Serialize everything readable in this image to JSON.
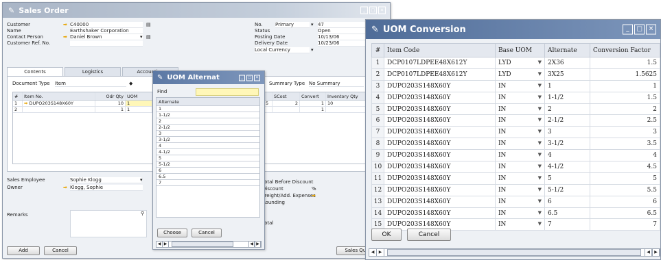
{
  "sales_order": {
    "title": "Sales Order",
    "left_fields": [
      {
        "label": "Customer",
        "value": "C40000",
        "arrow": true
      },
      {
        "label": "Name",
        "value": "Earthshaker Corporation",
        "arrow": false
      },
      {
        "label": "Contact Person",
        "value": "Daniel Brown",
        "arrow": true
      },
      {
        "label": "Customer Ref. No.",
        "value": "",
        "arrow": false
      }
    ],
    "right_fields": [
      {
        "label": "No.",
        "value": "Primary",
        "value2": "47"
      },
      {
        "label": "Status",
        "value": "Open"
      },
      {
        "label": "Posting Date",
        "value": "10/13/06"
      },
      {
        "label": "Delivery Date",
        "value": "10/23/06"
      }
    ],
    "currency": "Local Currency",
    "tabs": [
      "Contents",
      "Logistics",
      "Accounting"
    ],
    "doc_type_label": "Document Type",
    "doc_type_value": "Item",
    "summary_type_label": "Summary Type",
    "summary_type_value": "No Summary",
    "grid_headers": [
      "#",
      "Item No.",
      "Odr Qty",
      "UOM"
    ],
    "grid_rows": [
      {
        "n": "1",
        "item": "DUPO203S148X60Y",
        "qty": "10",
        "uom": "1"
      },
      {
        "n": "2",
        "item": "",
        "qty": "1",
        "uom": "1"
      }
    ],
    "right_grid_headers": [
      "SCost",
      "Convert",
      "Inventory Qty"
    ],
    "right_grid_rows": [
      {
        "a": "5",
        "b": "2",
        "c": "1",
        "d": "10"
      },
      {
        "a": "",
        "b": "",
        "c": "1",
        "d": ""
      }
    ],
    "sales_employee_label": "Sales Employee",
    "sales_employee_value": "Sophie Klogg",
    "owner_label": "Owner",
    "owner_value": "Klogg, Sophie",
    "remarks_label": "Remarks",
    "totals": [
      "Total Before Discount",
      "Discount",
      "Freight/Add. Expenses",
      "Rounding",
      "",
      "Total"
    ],
    "discount_unit": "%",
    "add_label": "Add",
    "cancel_label": "Cancel",
    "sales_quote_label": "Sales Quo"
  },
  "uom_alternate": {
    "title": "UOM Alternat",
    "find_label": "Find",
    "column": "Alternate",
    "items": [
      "1",
      "1-1/2",
      "2",
      "2-1/2",
      "3",
      "3-1/2",
      "4",
      "4-1/2",
      "5",
      "5-1/2",
      "6",
      "6.5",
      "7"
    ],
    "choose_label": "Choose",
    "cancel_label": "Cancel"
  },
  "uom_conversion": {
    "title": "UOM Conversion",
    "headers": [
      "#",
      "Item Code",
      "Base UOM",
      "Alternate",
      "Conversion Factor"
    ],
    "rows": [
      {
        "n": "1",
        "code": "DCP0107LDPEE48X612Y",
        "base": "LYD",
        "alt": "2X36",
        "factor": "1.5"
      },
      {
        "n": "2",
        "code": "DCP0107LDPEE48X612Y",
        "base": "LYD",
        "alt": "3X25",
        "factor": "1.5625"
      },
      {
        "n": "3",
        "code": "DUPO203S148X60Y",
        "base": "IN",
        "alt": "1",
        "factor": "1"
      },
      {
        "n": "4",
        "code": "DUPO203S148X60Y",
        "base": "IN",
        "alt": "1-1/2",
        "factor": "1.5"
      },
      {
        "n": "5",
        "code": "DUPO203S148X60Y",
        "base": "IN",
        "alt": "2",
        "factor": "2"
      },
      {
        "n": "6",
        "code": "DUPO203S148X60Y",
        "base": "IN",
        "alt": "2-1/2",
        "factor": "2.5"
      },
      {
        "n": "7",
        "code": "DUPO203S148X60Y",
        "base": "IN",
        "alt": "3",
        "factor": "3"
      },
      {
        "n": "8",
        "code": "DUPO203S148X60Y",
        "base": "IN",
        "alt": "3-1/2",
        "factor": "3.5"
      },
      {
        "n": "9",
        "code": "DUPO203S148X60Y",
        "base": "IN",
        "alt": "4",
        "factor": "4"
      },
      {
        "n": "10",
        "code": "DUPO203S148X60Y",
        "base": "IN",
        "alt": "4-1/2",
        "factor": "4.5"
      },
      {
        "n": "11",
        "code": "DUPO203S148X60Y",
        "base": "IN",
        "alt": "5",
        "factor": "5"
      },
      {
        "n": "12",
        "code": "DUPO203S148X60Y",
        "base": "IN",
        "alt": "5-1/2",
        "factor": "5.5"
      },
      {
        "n": "13",
        "code": "DUPO203S148X60Y",
        "base": "IN",
        "alt": "6",
        "factor": "6"
      },
      {
        "n": "14",
        "code": "DUPO203S148X60Y",
        "base": "IN",
        "alt": "6.5",
        "factor": "6.5"
      },
      {
        "n": "15",
        "code": "DUPO203S148X60Y",
        "base": "IN",
        "alt": "7",
        "factor": "7"
      }
    ],
    "ok_label": "OK",
    "cancel_label": "Cancel"
  }
}
